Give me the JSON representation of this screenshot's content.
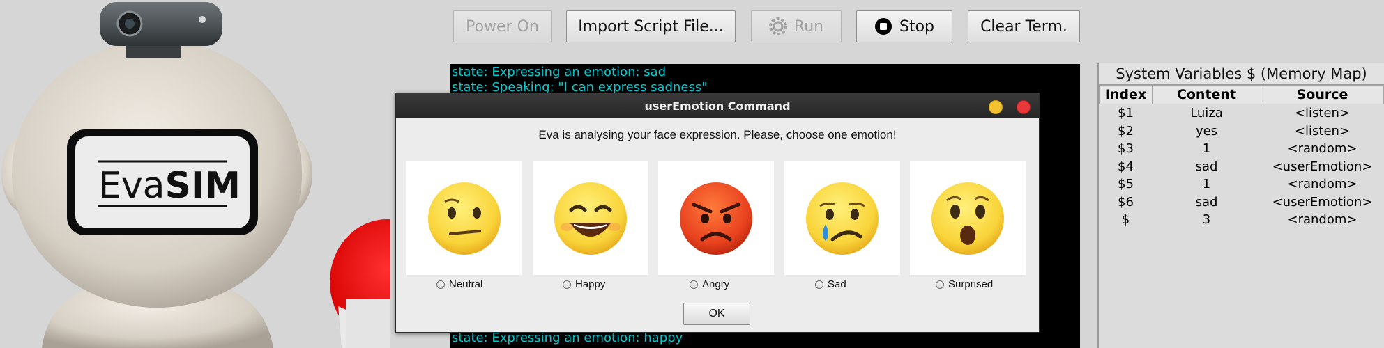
{
  "robot": {
    "logo_text_light": "Eva",
    "logo_text_bold": "SIM"
  },
  "toolbar": {
    "power_on": "Power On",
    "import_script": "Import Script File...",
    "run": "Run",
    "stop": "Stop",
    "clear_term": "Clear Term."
  },
  "terminal": {
    "lines": [
      "state: Expressing an emotion: sad",
      "state: Speaking: \"I can express sadness\"",
      "state: Expressing an emotion: happy"
    ]
  },
  "memory_map": {
    "title": "System Variables $ (Memory Map)",
    "headers": [
      "Index",
      "Content",
      "Source"
    ],
    "rows": [
      [
        "$1",
        "Luiza",
        "<listen>"
      ],
      [
        "$2",
        "yes",
        "<listen>"
      ],
      [
        "$3",
        "1",
        "<random>"
      ],
      [
        "$4",
        "sad",
        "<userEmotion>"
      ],
      [
        "$5",
        "1",
        "<random>"
      ],
      [
        "$6",
        "sad",
        "<userEmotion>"
      ],
      [
        "$",
        "3",
        "<random>"
      ]
    ]
  },
  "dialog": {
    "title": "userEmotion Command",
    "prompt": "Eva is analysing your face expression. Please, choose one emotion!",
    "ok_label": "OK",
    "options": [
      {
        "label": "Neutral",
        "icon": "neutral-face-icon"
      },
      {
        "label": "Happy",
        "icon": "happy-face-icon"
      },
      {
        "label": "Angry",
        "icon": "angry-face-icon"
      },
      {
        "label": "Sad",
        "icon": "sad-face-icon"
      },
      {
        "label": "Surprised",
        "icon": "surprised-face-icon"
      }
    ]
  },
  "colors": {
    "terminal_text": "#00ccd1",
    "terminal_bg": "#000000",
    "emoji_yellow": "#f9d43a",
    "emoji_angry": "#e8421e",
    "close_button": "#e8383a",
    "minimize_button": "#f2c230"
  }
}
